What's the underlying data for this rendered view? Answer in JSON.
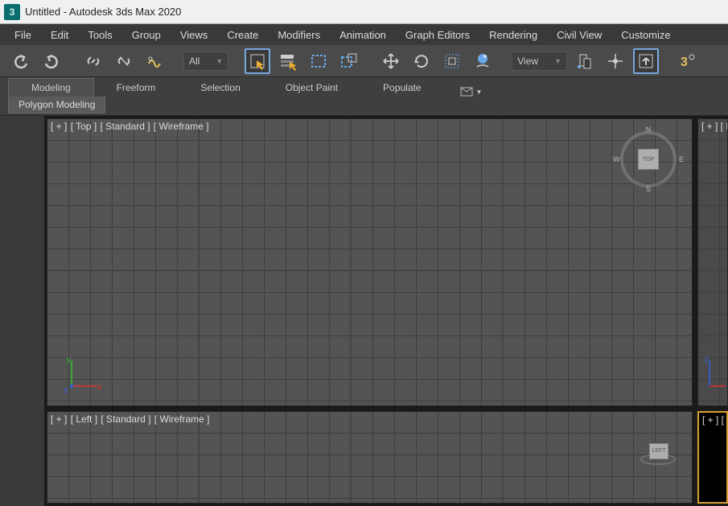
{
  "app": {
    "logo_letter": "3",
    "title": "Untitled - Autodesk 3ds Max 2020"
  },
  "menu": [
    "File",
    "Edit",
    "Tools",
    "Group",
    "Views",
    "Create",
    "Modifiers",
    "Animation",
    "Graph Editors",
    "Rendering",
    "Civil View",
    "Customize"
  ],
  "toolbar": {
    "filter_dropdown": "All",
    "view_dropdown": "View"
  },
  "ribbon": {
    "tabs": [
      "Modeling",
      "Freeform",
      "Selection",
      "Object Paint",
      "Populate"
    ],
    "active_tab": 0,
    "group_label": "Polygon Modeling"
  },
  "viewports": {
    "top": {
      "labels": [
        "[ + ]",
        "[ Top ]",
        "[ Standard ]",
        "[ Wireframe ]"
      ],
      "cube_face": "TOP",
      "compass": {
        "n": "N",
        "s": "S",
        "e": "E",
        "w": "W"
      }
    },
    "left": {
      "labels": [
        "[ + ]",
        "[ Left ]",
        "[ Standard ]",
        "[ Wireframe ]"
      ],
      "cube_face": "LEFT"
    },
    "side_partial_label": "[ + ] [ F"
  }
}
